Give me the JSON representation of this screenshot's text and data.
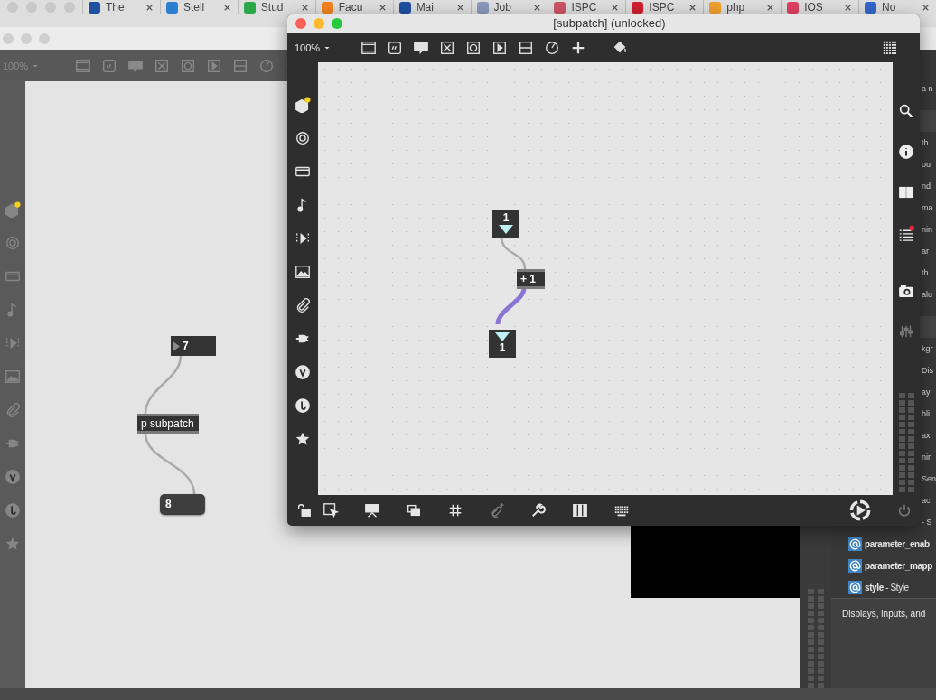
{
  "browser_tabs": [
    {
      "label": "The"
    },
    {
      "label": "Stell"
    },
    {
      "label": "Stud"
    },
    {
      "label": "Facu"
    },
    {
      "label": "Mai"
    },
    {
      "label": "Job"
    },
    {
      "label": "ISPC"
    },
    {
      "label": "ISPC"
    },
    {
      "label": "php"
    },
    {
      "label": "IOS"
    },
    {
      "label": "No"
    }
  ],
  "back_patcher": {
    "zoom": "100%",
    "objects": [
      {
        "kind": "number",
        "text": "7"
      },
      {
        "kind": "object",
        "text": "p subpatch"
      },
      {
        "kind": "message",
        "text": "8"
      }
    ]
  },
  "front_patcher": {
    "title": "[subpatch] (unlocked)",
    "zoom": "100%",
    "objects": [
      {
        "kind": "inlet",
        "text": "1"
      },
      {
        "kind": "object",
        "text": "+ 1"
      },
      {
        "kind": "outlet",
        "text": "1"
      }
    ]
  },
  "inspector": {
    "sections": [
      {
        "rows": [
          "a n"
        ]
      },
      {
        "rows": [
          "th",
          "ou",
          "nd",
          "ma",
          "nin",
          "ar",
          "th",
          "alu"
        ]
      },
      {
        "rows": [
          "kgr",
          "Dis",
          "ay",
          "hli",
          "ax",
          "nir",
          "Sen",
          "ac",
          "- S"
        ]
      }
    ],
    "attributes": [
      "**parameter_enab**",
      "**parameter_mapp**",
      "**style** - Style"
    ],
    "description": "Displays, inputs, and"
  }
}
